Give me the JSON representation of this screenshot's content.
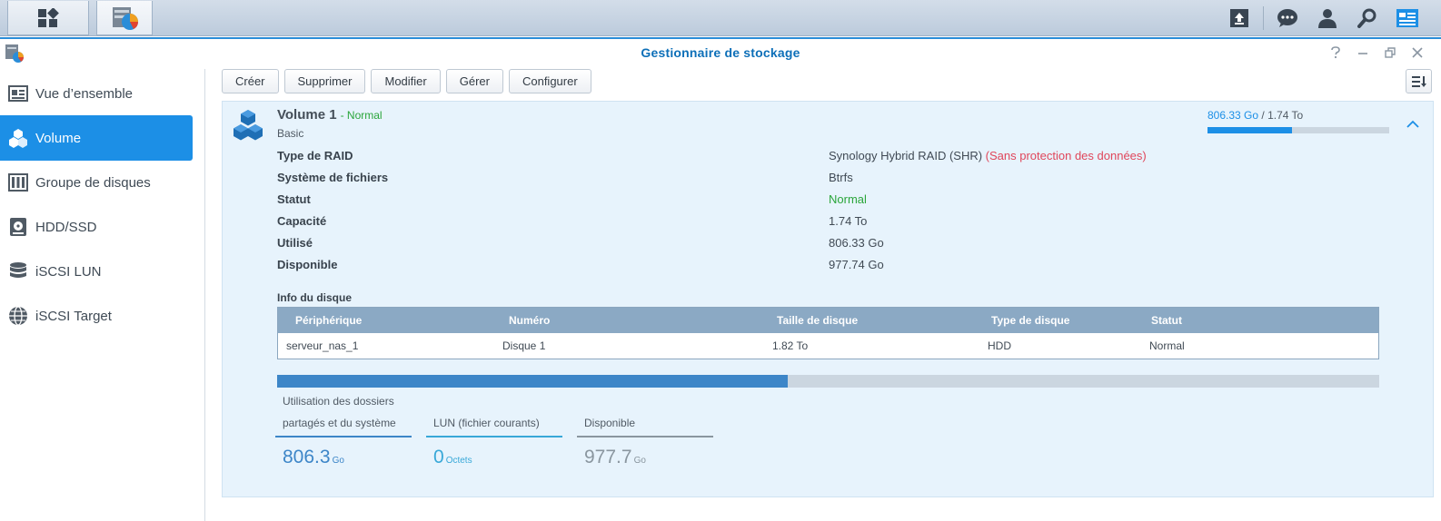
{
  "window": {
    "title": "Gestionnaire de stockage"
  },
  "toolbar": {
    "buttons": [
      "Créer",
      "Supprimer",
      "Modifier",
      "Gérer",
      "Configurer"
    ]
  },
  "sidebar": {
    "items": [
      {
        "label": "Vue d’ensemble",
        "icon": "overview-icon",
        "active": false
      },
      {
        "label": "Volume",
        "icon": "volume-icon",
        "active": true
      },
      {
        "label": "Groupe de disques",
        "icon": "disk-group-icon",
        "active": false
      },
      {
        "label": "HDD/SSD",
        "icon": "hdd-icon",
        "active": false
      },
      {
        "label": "iSCSI LUN",
        "icon": "database-icon",
        "active": false
      },
      {
        "label": "iSCSI Target",
        "icon": "globe-icon",
        "active": false
      }
    ]
  },
  "volume": {
    "name": "Volume 1",
    "status_text": "- Normal",
    "subtitle": "Basic",
    "usage_used": "806.33 Go",
    "usage_separator": " / ",
    "usage_total": "1.74 To",
    "usage_fraction": 0.4634,
    "properties": [
      {
        "label": "Type de RAID",
        "value": "Synology Hybrid RAID (SHR)",
        "note": "(Sans protection des données)"
      },
      {
        "label": "Système de fichiers",
        "value": "Btrfs"
      },
      {
        "label": "Statut",
        "value": "Normal"
      },
      {
        "label": "Capacité",
        "value": "1.74 To"
      },
      {
        "label": "Utilisé",
        "value": "806.33 Go"
      },
      {
        "label": "Disponible",
        "value": "977.74 Go"
      }
    ],
    "disk_info_title": "Info du disque",
    "disk_table": {
      "headers": [
        "Périphérique",
        "Numéro",
        "Taille de disque",
        "Type de disque",
        "Statut"
      ],
      "rows": [
        [
          "serveur_nas_1",
          "Disque 1",
          "1.82 To",
          "HDD",
          "Normal"
        ]
      ]
    },
    "legend": [
      {
        "label_line1": "Utilisation des dossiers",
        "label_line2": "partagés et du système",
        "value": "806.3",
        "unit": "Go"
      },
      {
        "label_line1": "",
        "label_line2": "LUN (fichier courants)",
        "value": "0",
        "unit": "Octets"
      },
      {
        "label_line1": "",
        "label_line2": "Disponible",
        "value": "977.7",
        "unit": "Go"
      }
    ]
  },
  "colors": {
    "accent": "#1c8fe6",
    "status_ok": "#2aa53a",
    "warning": "#e0465a",
    "lun": "#38a8d8",
    "available": "#8a969f"
  }
}
